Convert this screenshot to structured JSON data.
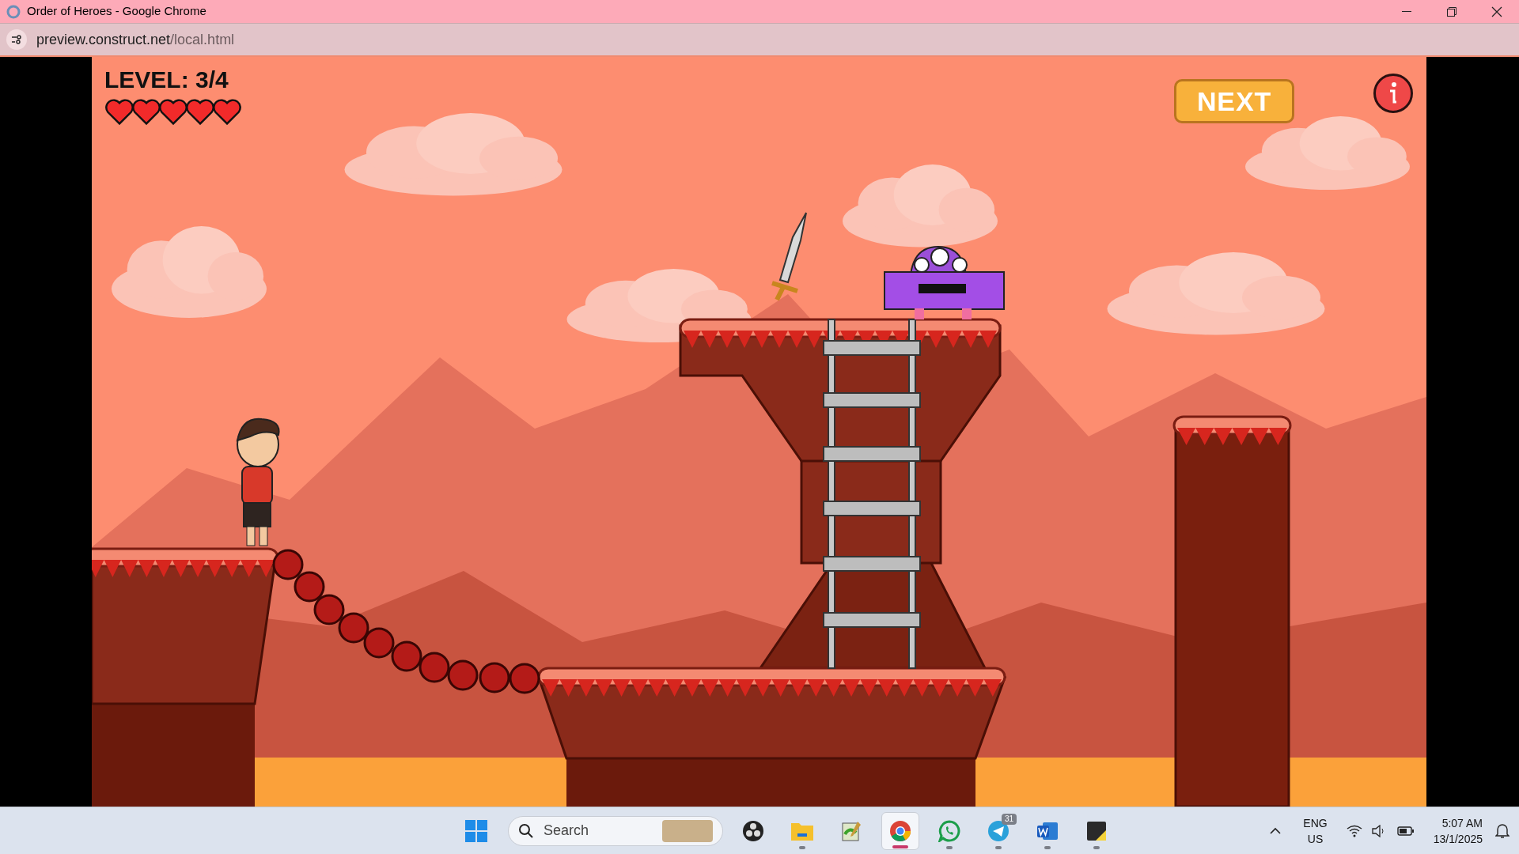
{
  "window": {
    "title": "Order of Heroes - Google Chrome"
  },
  "address_bar": {
    "url_host": "preview.construct.net",
    "url_path": "/local.html"
  },
  "game": {
    "level_label": "LEVEL: 3/4",
    "hearts": [
      {
        "full": true
      },
      {
        "full": true
      },
      {
        "full": true
      },
      {
        "full": true
      },
      {
        "full": true
      }
    ],
    "next_button": "NEXT"
  },
  "taskbar": {
    "search": {
      "placeholder": "Search"
    },
    "apps": [
      {
        "kind": "obs",
        "selected": false,
        "running": false
      },
      {
        "kind": "files",
        "selected": false,
        "running": true
      },
      {
        "kind": "notepad",
        "selected": false,
        "running": false
      },
      {
        "kind": "chrome",
        "selected": true,
        "running": true
      },
      {
        "kind": "whatsapp",
        "selected": false,
        "running": true
      },
      {
        "kind": "telegram",
        "selected": false,
        "running": true,
        "badge": "31"
      },
      {
        "kind": "word",
        "selected": false,
        "running": true
      },
      {
        "kind": "notes",
        "selected": false,
        "running": true
      }
    ],
    "language": "ENG",
    "region": "US",
    "time": "5:07 AM",
    "date": "13/1/2025"
  }
}
